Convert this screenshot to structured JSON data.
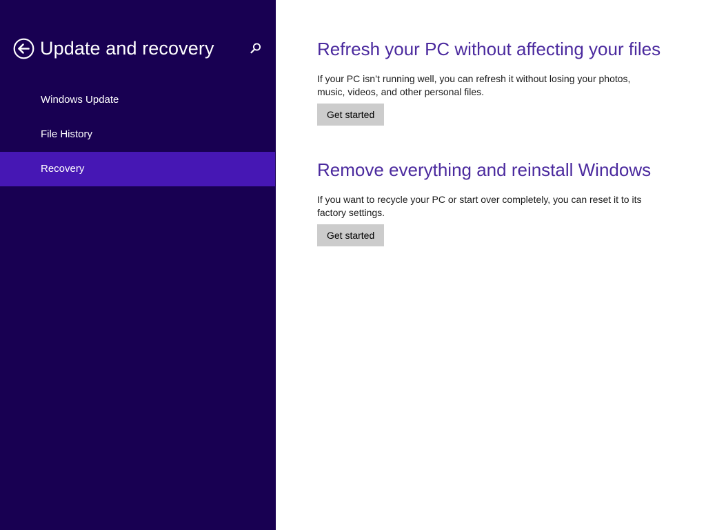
{
  "sidebar": {
    "title": "Update and recovery",
    "back_icon": "back-arrow-icon",
    "search_icon": "search-icon",
    "items": [
      {
        "label": "Windows Update",
        "selected": false
      },
      {
        "label": "File History",
        "selected": false
      },
      {
        "label": "Recovery",
        "selected": true
      }
    ]
  },
  "main": {
    "sections": [
      {
        "heading": "Refresh your PC without affecting your files",
        "description": "If your PC isn’t running well, you can refresh it without losing your photos, music, videos, and other personal files.",
        "button_label": "Get started"
      },
      {
        "heading": "Remove everything and reinstall Windows",
        "description": "If you want to recycle your PC or start over completely, you can reset it to its factory settings.",
        "button_label": "Get started"
      }
    ]
  },
  "colors": {
    "sidebar_background": "#180052",
    "selected_item": "#4617b4",
    "heading_accent": "#4b2a9e",
    "button_background": "#cccccc"
  }
}
